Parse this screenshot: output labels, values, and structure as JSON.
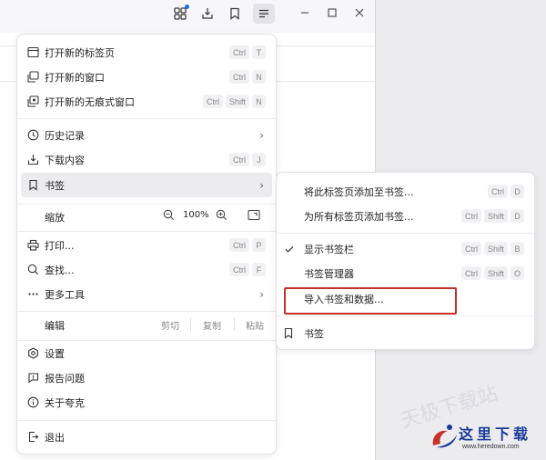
{
  "main_menu": {
    "items": [
      {
        "label": "打开新的标签页",
        "keys": [
          "Ctrl",
          "T"
        ]
      },
      {
        "label": "打开新的窗口",
        "keys": [
          "Ctrl",
          "N"
        ]
      },
      {
        "label": "打开新的无痕式窗口",
        "keys": [
          "Ctrl",
          "Shift",
          "N"
        ]
      },
      {
        "label": "历史记录"
      },
      {
        "label": "下载内容",
        "keys": [
          "Ctrl",
          "J"
        ]
      },
      {
        "label": "书签"
      },
      {
        "label": "打印...",
        "keys": [
          "Ctrl",
          "P"
        ]
      },
      {
        "label": "查找...",
        "keys": [
          "Ctrl",
          "F"
        ]
      },
      {
        "label": "更多工具"
      },
      {
        "label": "设置"
      },
      {
        "label": "报告问题"
      },
      {
        "label": "关于夸克"
      },
      {
        "label": "退出"
      }
    ],
    "zoom": {
      "label": "缩放",
      "value": "100%"
    },
    "edit": {
      "label": "编辑",
      "cut": "剪切",
      "copy": "复制",
      "paste": "粘贴"
    }
  },
  "bookmark_submenu": {
    "items": [
      {
        "label": "将此标签页添加至书签...",
        "keys": [
          "Ctrl",
          "D"
        ]
      },
      {
        "label": "为所有标签页添加书签...",
        "keys": [
          "Ctrl",
          "Shift",
          "D"
        ]
      },
      {
        "label": "显示书签栏",
        "keys": [
          "Ctrl",
          "Shift",
          "B"
        ]
      },
      {
        "label": "书签管理器",
        "keys": [
          "Ctrl",
          "Shift",
          "O"
        ]
      },
      {
        "label": "导入书签和数据..."
      },
      {
        "label": "书签"
      }
    ]
  },
  "watermark": {
    "text": "天极下载站"
  },
  "logo": {
    "text": "这里下载",
    "url": "www.heredown.com"
  },
  "colors": {
    "highlight": "#c8302a",
    "badge": "#1a6cf0"
  },
  "icons": [
    "extensions-icon",
    "download-icon",
    "bookmark-icon",
    "menu-icon",
    "minimize-icon",
    "maximize-icon",
    "close-icon"
  ]
}
